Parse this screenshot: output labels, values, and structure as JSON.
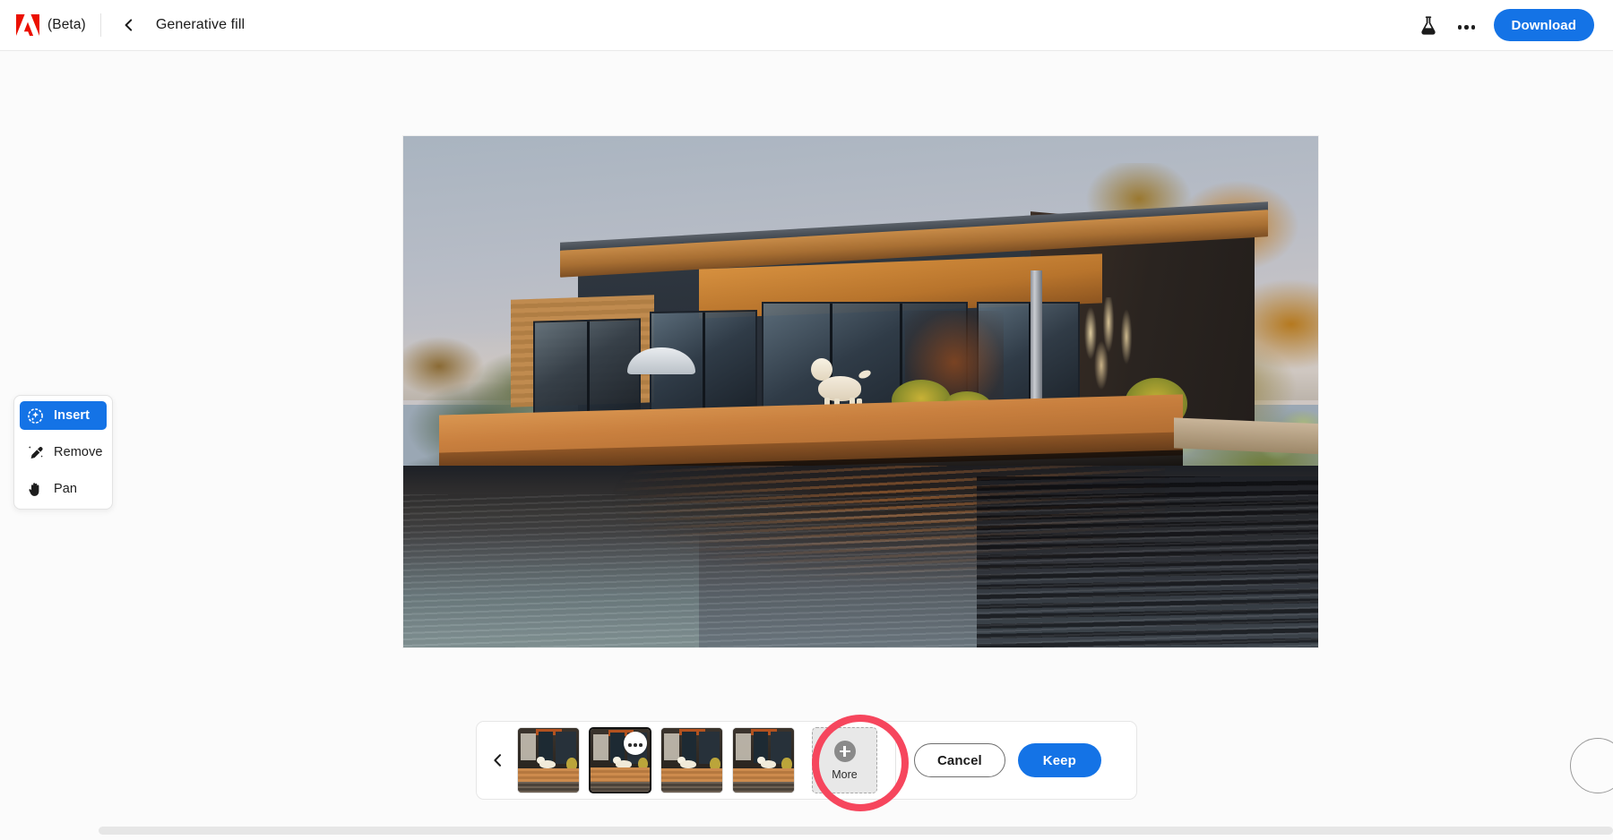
{
  "app": {
    "brand": "adobe-logo",
    "beta_label": "(Beta)",
    "title": "Generative fill"
  },
  "header": {
    "back_icon": "chevron-left-icon",
    "lab_icon": "flask-icon",
    "overflow_icon": "more-horizontal-icon",
    "download_label": "Download"
  },
  "tools": {
    "items": [
      {
        "label": "Insert",
        "icon": "sparkle-circle-icon",
        "active": true
      },
      {
        "label": "Remove",
        "icon": "remove-brush-icon",
        "active": false
      },
      {
        "label": "Pan",
        "icon": "hand-icon",
        "active": false
      }
    ]
  },
  "canvas": {
    "image_alt": "Modern lakeside timber house at golden hour with a white dog on the deck",
    "brush_cursor": "brush-cursor"
  },
  "filmstrip": {
    "prev_icon": "chevron-left-icon",
    "thumbnails": [
      {
        "label": "Variation 1",
        "selected": false,
        "badge": null
      },
      {
        "label": "Variation 2",
        "selected": true,
        "badge": "more-horizontal-icon"
      },
      {
        "label": "Variation 3",
        "selected": false,
        "badge": null
      },
      {
        "label": "Variation 4",
        "selected": false,
        "badge": null
      }
    ],
    "more": {
      "label": "More",
      "icon": "plus-circle-icon"
    },
    "cancel_label": "Cancel",
    "keep_label": "Keep"
  },
  "annotation": {
    "target": "more-button",
    "shape": "circle",
    "color": "#f6465d"
  },
  "colors": {
    "accent_blue": "#1473e6",
    "annotation_red": "#f6465d",
    "adobe_red": "#eb1000",
    "page_background": "#fbfbfb",
    "panel_background": "#ffffff",
    "more_button_background": "#e8e8e8"
  }
}
